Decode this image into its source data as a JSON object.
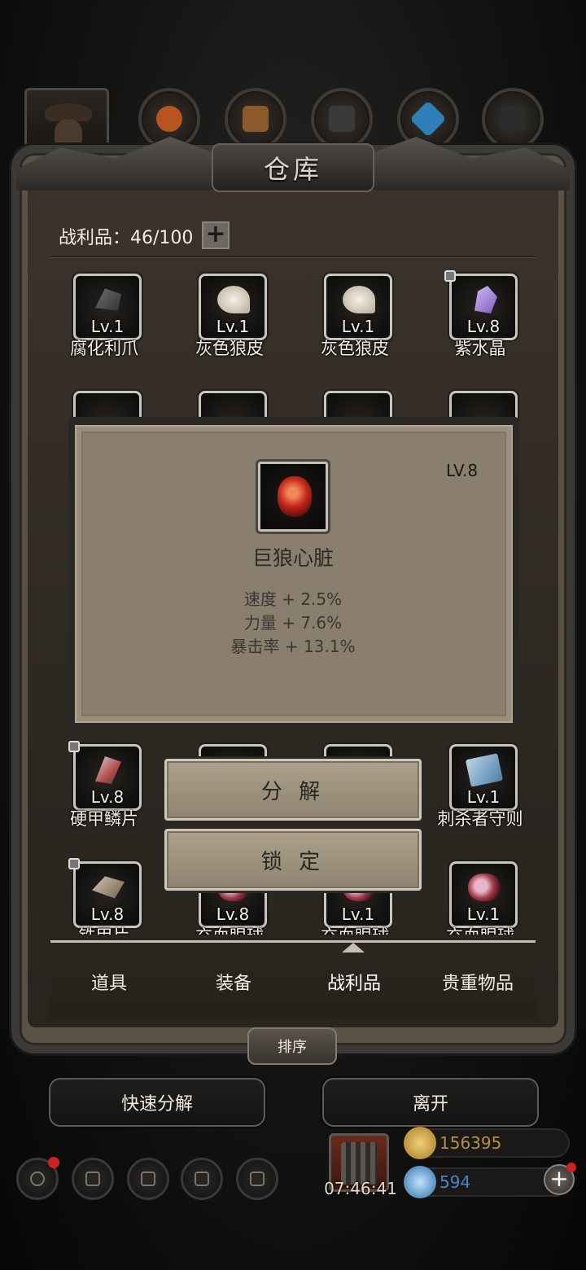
{
  "header": {
    "title": "仓库",
    "category_icons": [
      "hero-portrait-icon",
      "orange-ore-icon",
      "wood-plank-icon",
      "iron-ingot-icon",
      "blue-crystal-icon",
      "dark-ore-icon"
    ]
  },
  "inventory": {
    "count_label": "战利品：46/100",
    "add_label": "+",
    "row1": [
      {
        "lv": "Lv.1",
        "name": "腐化利爪",
        "icon": "claw-icon",
        "locked": false
      },
      {
        "lv": "Lv.1",
        "name": "灰色狼皮",
        "icon": "fur-icon",
        "locked": false
      },
      {
        "lv": "Lv.1",
        "name": "灰色狼皮",
        "icon": "fur-icon",
        "locked": false
      },
      {
        "lv": "Lv.8",
        "name": "紫水晶",
        "icon": "amethyst-icon",
        "locked": true
      }
    ],
    "row4": [
      {
        "lv": "Lv.8",
        "name": "硬甲鳞片",
        "icon": "armor-scale-icon",
        "locked": true
      },
      {
        "lv": "Lv.1",
        "name": "刺杀者守则",
        "icon": "book-icon",
        "locked": false
      }
    ],
    "row5": [
      {
        "lv": "Lv.8",
        "name": "铁甲片",
        "icon": "bone-plate-icon",
        "locked": true
      },
      {
        "lv": "Lv.8",
        "name": "充血眼球",
        "icon": "eyeball-icon",
        "locked": false
      },
      {
        "lv": "Lv.1",
        "name": "充血眼球",
        "icon": "eyeball-icon",
        "locked": false
      },
      {
        "lv": "Lv.1",
        "name": "充血眼球",
        "icon": "eyeball-icon",
        "locked": false
      }
    ]
  },
  "tooltip": {
    "level": "LV.8",
    "name": "巨狼心脏",
    "icon": "heart-icon",
    "stats": [
      "速度 + 2.5%",
      "力量 + 7.6%",
      "暴击率 + 13.1%"
    ]
  },
  "actions": {
    "decompose": "分 解",
    "lock": "锁 定"
  },
  "tabs": {
    "items": [
      "道具",
      "装备",
      "战利品",
      "贵重物品"
    ],
    "active": "战利品"
  },
  "footer": {
    "sort": "排序",
    "quick_decompose": "快速分解",
    "leave": "离开",
    "timer": "07:46:41",
    "gold": "156395",
    "gems": "594",
    "gold_color": "#c09a4a",
    "gem_color": "#4a7ec0"
  }
}
